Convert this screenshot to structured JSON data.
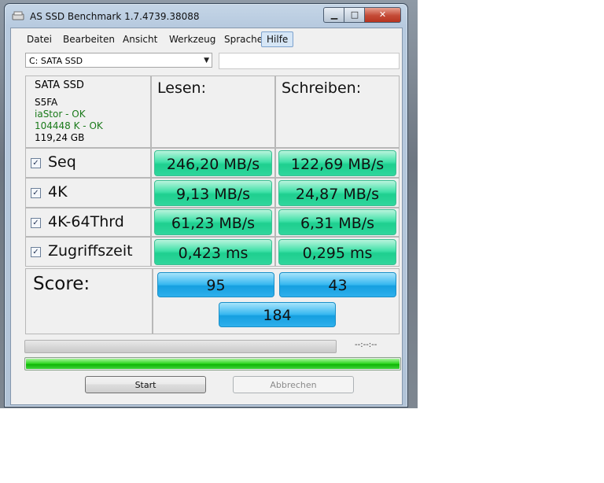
{
  "window": {
    "title": "AS SSD Benchmark 1.7.4739.38088"
  },
  "menu": [
    "Datei",
    "Bearbeiten",
    "Ansicht",
    "Werkzeug",
    "Sprache",
    "Hilfe"
  ],
  "drive_select": {
    "value": "C: SATA SSD"
  },
  "drive_info": {
    "name": "SATA SSD",
    "model": "S5FA",
    "driver": "iaStor - OK",
    "alignment": "104448 K - OK",
    "size": "119,24 GB"
  },
  "columns": {
    "read": "Lesen:",
    "write": "Schreiben:"
  },
  "rows": [
    {
      "label": "Seq",
      "read": "246,20 MB/s",
      "write": "122,69 MB/s"
    },
    {
      "label": "4K",
      "read": "9,13 MB/s",
      "write": "24,87 MB/s"
    },
    {
      "label": "4K-64Thrd",
      "read": "61,23 MB/s",
      "write": "6,31 MB/s"
    },
    {
      "label": "Zugriffszeit",
      "read": "0,423 ms",
      "write": "0,295 ms"
    }
  ],
  "score": {
    "label": "Score:",
    "read": "95",
    "write": "43",
    "total": "184"
  },
  "progress": {
    "time": "--:--:--",
    "test_progress": 0.0,
    "overall_progress": 1.0
  },
  "buttons": {
    "start": "Start",
    "abort": "Abbrechen"
  },
  "colors": {
    "result": "#30d69c",
    "score": "#2fb0ec",
    "progress": "#2ad41d",
    "ok_text": "#1a7a1a"
  }
}
